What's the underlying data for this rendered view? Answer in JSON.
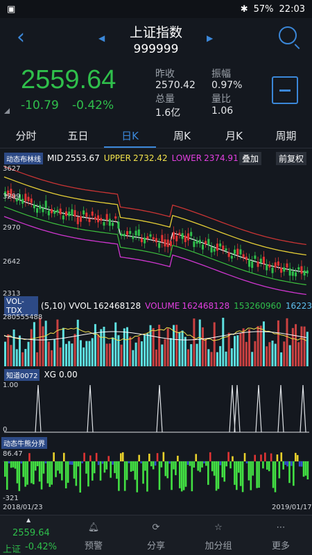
{
  "statusbar": {
    "battery": "57%",
    "time": "22:03"
  },
  "header": {
    "title": "上证指数",
    "code": "999999"
  },
  "quote": {
    "price": "2559.64",
    "change": "-10.79",
    "change_pct": "-0.42%",
    "stats": [
      {
        "label": "昨收",
        "value": "2570.42"
      },
      {
        "label": "振幅",
        "value": "0.97%"
      },
      {
        "label": "总量",
        "value": "1.6亿"
      },
      {
        "label": "量比",
        "value": "1.06"
      }
    ]
  },
  "tabs": [
    "分时",
    "五日",
    "日K",
    "周K",
    "月K",
    "周期"
  ],
  "active_tab": "日K",
  "main_indicator": {
    "button": "动态布林线",
    "mid_label": "MID",
    "mid_value": "2553.67",
    "upper_label": "UPPER",
    "upper_value": "2732.42",
    "lower_label": "LOWER",
    "lower_value": "2374.91",
    "overlay_button": "叠加",
    "adjust_button": "前复权",
    "y_ticks": [
      "3627",
      "3299",
      "2970",
      "2642",
      "2313"
    ]
  },
  "volume_indicator": {
    "button": "VOL-TDX",
    "params": "(5,10)",
    "vvol_label": "VVOL",
    "vvol_value": "162468128",
    "volume_label": "VOLUME",
    "volume_value": "162468128",
    "ma5": "153260960",
    "ma10": "16223",
    "y_tick": "280555488"
  },
  "xg_indicator": {
    "button": "知道0072",
    "label": "XG",
    "value": "0.00",
    "y_ticks": [
      "1.00",
      "0"
    ]
  },
  "bull_indicator": {
    "button": "动态牛熊分界",
    "y_ticks": [
      "86.47",
      "-321"
    ]
  },
  "date_range": {
    "start": "2018/01/23",
    "end": "2019/01/17"
  },
  "mini_quote": {
    "price": "2559.64",
    "name": "上证",
    "pct": "-0.42%"
  },
  "nav": [
    {
      "label": "预警",
      "icon": "bell-icon"
    },
    {
      "label": "分享",
      "icon": "share-icon"
    },
    {
      "label": "加分组",
      "icon": "star-icon"
    },
    {
      "label": "更多",
      "icon": "more-icon"
    }
  ],
  "colors": {
    "up": "#e03434",
    "down": "#2fbf4b",
    "accent": "#3b87d8",
    "vol_up": "#c94141",
    "vol_down": "#5ee0e0"
  }
}
